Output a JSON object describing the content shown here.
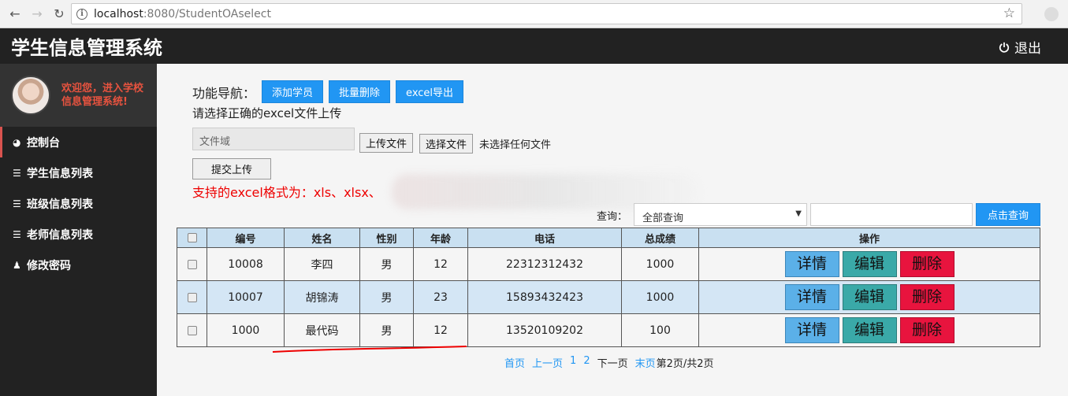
{
  "browser": {
    "url_host": "localhost",
    "url_path": ":8080/StudentOAselect"
  },
  "header": {
    "title": "学生信息管理系统",
    "logout_label": "退出"
  },
  "sidebar": {
    "welcome": "欢迎您，进入学校信息管理系统!",
    "items": [
      {
        "label": "控制台",
        "icon": "dashboard-icon"
      },
      {
        "label": "学生信息列表",
        "icon": "list-icon"
      },
      {
        "label": "班级信息列表",
        "icon": "list-icon"
      },
      {
        "label": "老师信息列表",
        "icon": "list-icon"
      },
      {
        "label": "修改密码",
        "icon": "user-icon"
      }
    ]
  },
  "toolbar": {
    "nav_label": "功能导航：",
    "add_label": "添加学员",
    "batch_delete_label": "批量删除",
    "export_label": "excel导出",
    "upload_hint": "请选择正确的excel文件上传",
    "file_field_text": "文件域",
    "upload_label": "上传文件",
    "choose_label": "选择文件",
    "no_file_text": "未选择任何文件",
    "submit_label": "提交上传",
    "format_tip": "支持的excel格式为：xls、xlsx、"
  },
  "query": {
    "label": "查询：",
    "select_value": "全部查询",
    "button_label": "点击查询"
  },
  "table": {
    "columns": [
      "编号",
      "姓名",
      "性别",
      "年龄",
      "电话",
      "总成绩",
      "操作"
    ],
    "rows": [
      {
        "id": "10008",
        "name": "李四",
        "gender": "男",
        "age": "12",
        "phone": "22312312432",
        "score": "1000"
      },
      {
        "id": "10007",
        "name": "胡锦涛",
        "gender": "男",
        "age": "23",
        "phone": "15893432423",
        "score": "1000"
      },
      {
        "id": "1000",
        "name": "最代码",
        "gender": "男",
        "age": "12",
        "phone": "13520109202",
        "score": "100"
      }
    ],
    "actions": {
      "detail": "详情",
      "edit": "编辑",
      "delete": "删除"
    }
  },
  "pager": {
    "first": "首页",
    "prev": "上一页",
    "page1": "1",
    "page2": "2",
    "next": "下一页",
    "last": "末页",
    "status": "第2页/共2页"
  },
  "colors": {
    "accent_blue": "#2196f3",
    "header_bg": "#222222",
    "danger": "#e8143e"
  }
}
